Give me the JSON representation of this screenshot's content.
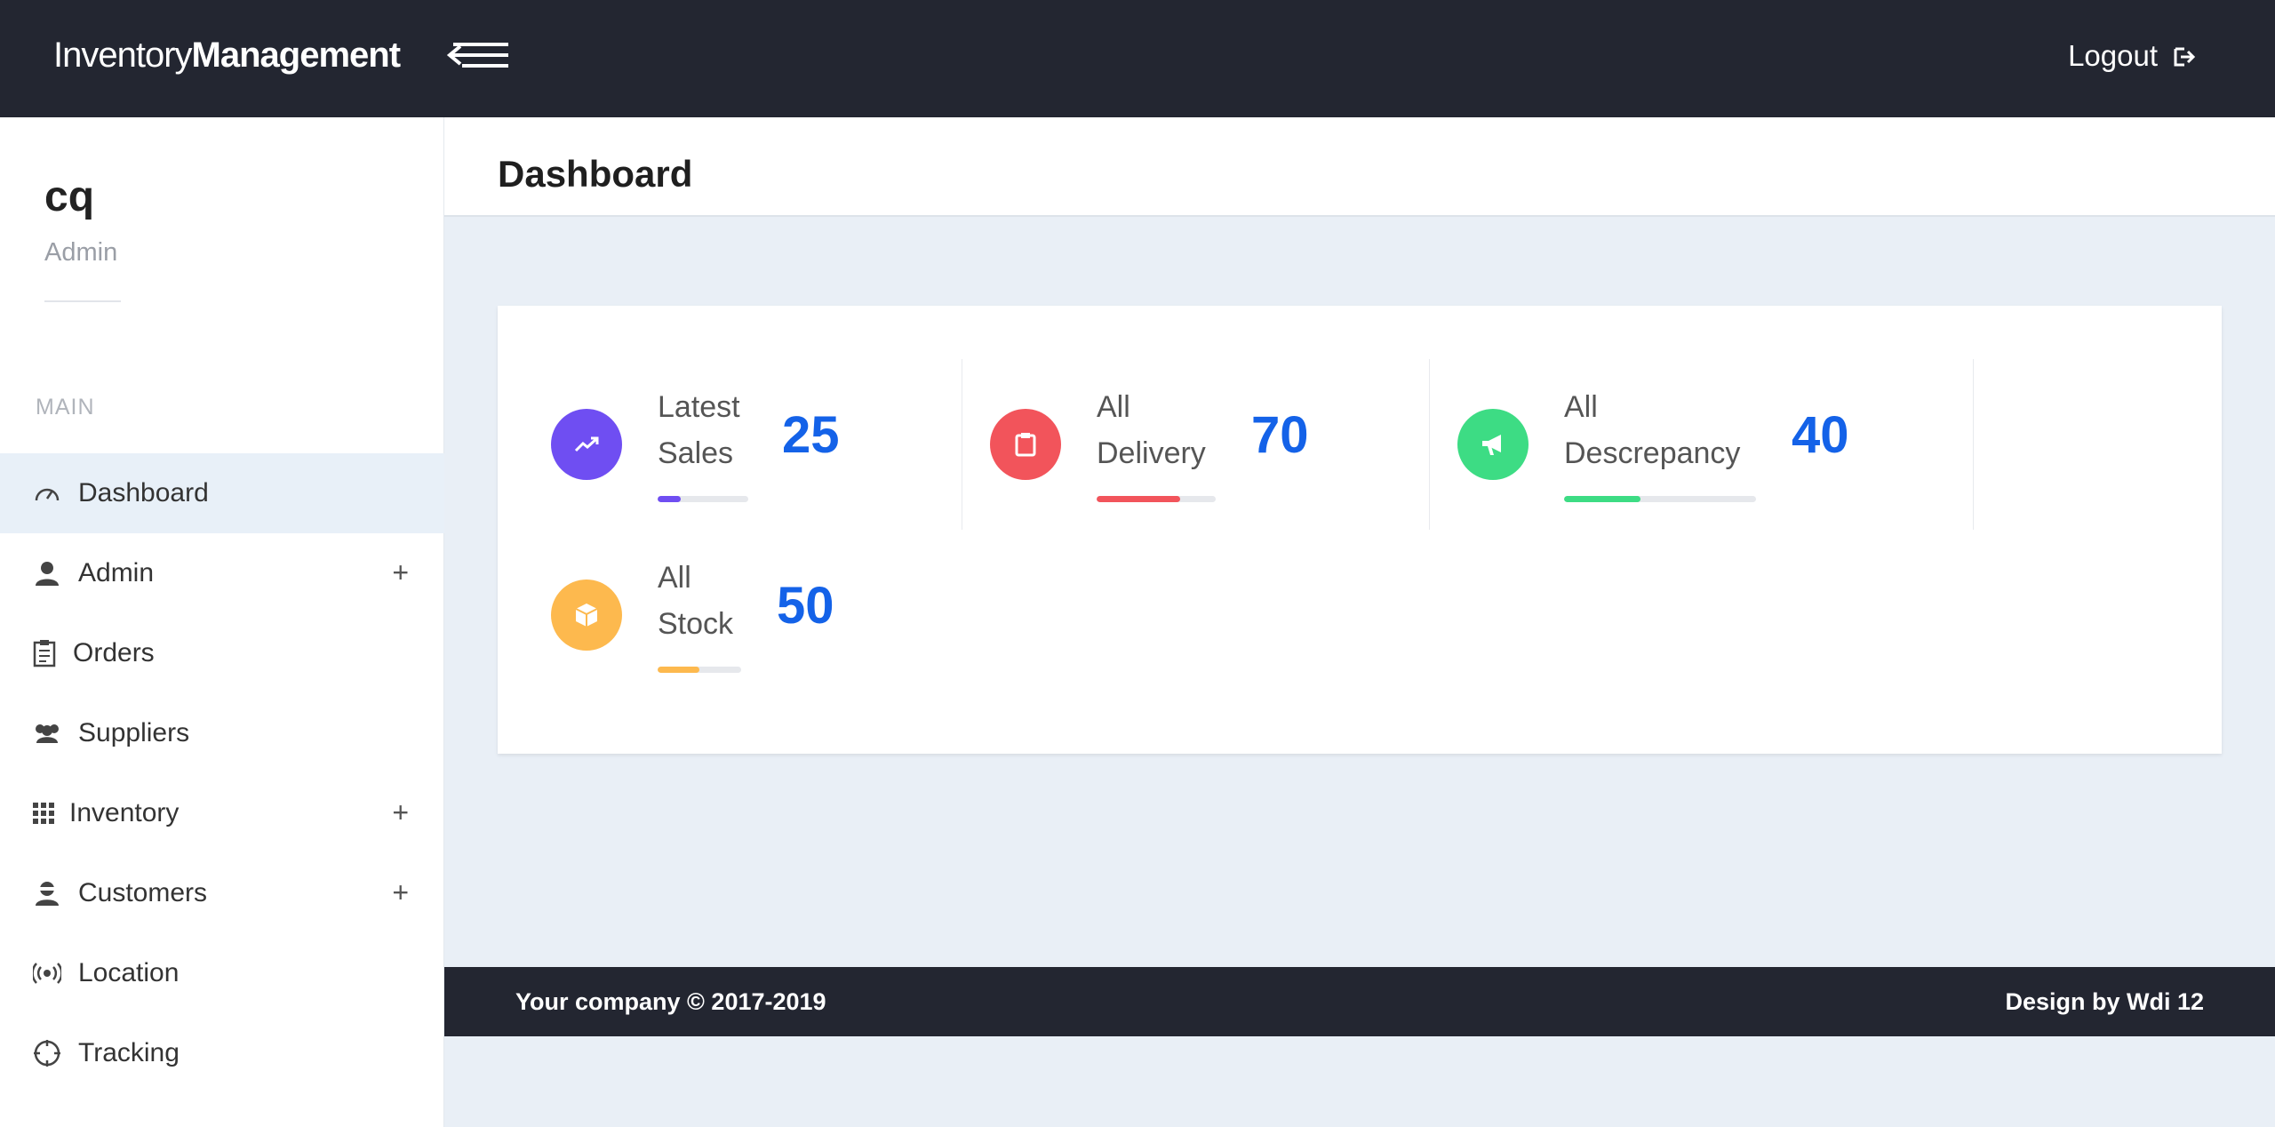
{
  "header": {
    "brand_light": "Inventory",
    "brand_bold": "Management",
    "logout_label": "Logout"
  },
  "user": {
    "name": "cq",
    "role": "Admin"
  },
  "sidebar": {
    "section_label": "MAIN",
    "items": [
      {
        "label": "Dashboard",
        "icon": "speedometer-icon",
        "expandable": false,
        "active": true
      },
      {
        "label": "Admin",
        "icon": "user-icon",
        "expandable": true
      },
      {
        "label": "Orders",
        "icon": "clipboard-icon",
        "expandable": false
      },
      {
        "label": "Suppliers",
        "icon": "group-icon",
        "expandable": false
      },
      {
        "label": "Inventory",
        "icon": "grid-icon",
        "expandable": true
      },
      {
        "label": "Customers",
        "icon": "customer-icon",
        "expandable": true
      },
      {
        "label": "Location",
        "icon": "broadcast-icon",
        "expandable": false
      },
      {
        "label": "Tracking",
        "icon": "crosshair-icon",
        "expandable": false
      }
    ],
    "expand_symbol": "+"
  },
  "page": {
    "title": "Dashboard"
  },
  "stats": [
    {
      "label_line1": "Latest",
      "label_line2": "Sales",
      "value": "25",
      "color": "#6f4ef2",
      "progress": 0.25,
      "icon": "trending-up-icon"
    },
    {
      "label_line1": "All",
      "label_line2": "Delivery",
      "value": "70",
      "color": "#f2545b",
      "progress": 0.7,
      "icon": "clipboard-icon"
    },
    {
      "label_line1": "All",
      "label_line2": "Descrepancy",
      "value": "40",
      "color": "#3ddc84",
      "progress": 0.4,
      "icon": "megaphone-icon"
    },
    {
      "label_line1": "All",
      "label_line2": "Stock",
      "value": "50",
      "color": "#fdb94e",
      "progress": 0.5,
      "icon": "cube-icon"
    }
  ],
  "footer": {
    "left": "Your company © 2017-2019",
    "right": "Design by Wdi 12"
  }
}
